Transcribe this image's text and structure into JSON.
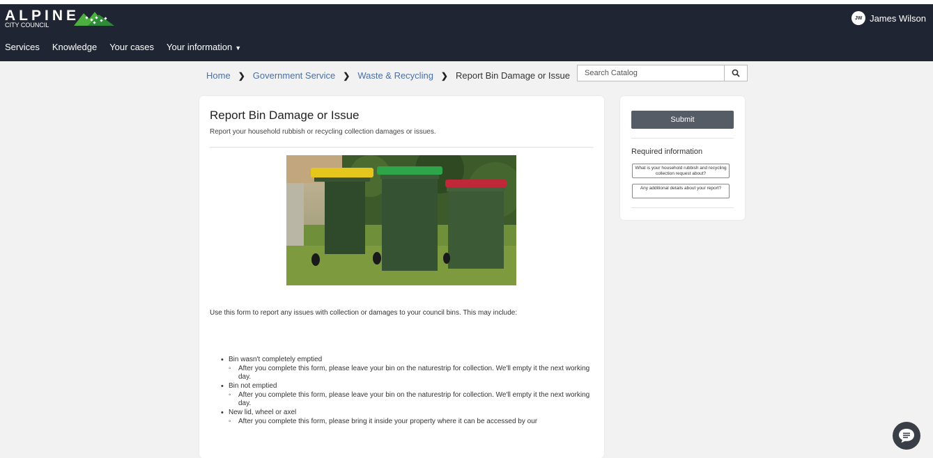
{
  "brand": {
    "name": "ALPINE",
    "sub": "CITY COUNCIL"
  },
  "user": {
    "initials": "JW",
    "name": "James Wilson"
  },
  "nav": {
    "services": "Services",
    "knowledge": "Knowledge",
    "your_cases": "Your cases",
    "your_information": "Your information"
  },
  "breadcrumb": {
    "home": "Home",
    "government_service": "Government Service",
    "waste_recycling": "Waste & Recycling",
    "current": "Report Bin Damage or Issue"
  },
  "search": {
    "placeholder": "Search Catalog"
  },
  "form": {
    "title": "Report Bin Damage or Issue",
    "subtitle": "Report your household rubbish or recycling collection damages or issues.",
    "intro": "Use this form to report any issues with collection or damages to your council bins. This may include:",
    "items": [
      {
        "label": "Bin wasn't completely emptied",
        "detail": "After you complete this form, please leave your bin on the naturestrip for collection. We'll empty it the next working day."
      },
      {
        "label": "Bin not emptied",
        "detail": "After you complete this form, please leave your bin on the naturestrip for collection. We'll empty it the next working day."
      },
      {
        "label": "New lid, wheel or axel",
        "detail": "After you complete this form, please bring it inside your property where it can be accessed by our"
      }
    ]
  },
  "sidebar": {
    "submit_label": "Submit",
    "required_title": "Required information",
    "required_items": [
      "What is your household rubbish and recycling collection request about?",
      "Any additional details about your report?"
    ]
  },
  "colors": {
    "header_bg": "#1f2532",
    "link": "#4a6fa5",
    "submit_bg": "#555c66",
    "logo_green": "#4caf3f"
  }
}
